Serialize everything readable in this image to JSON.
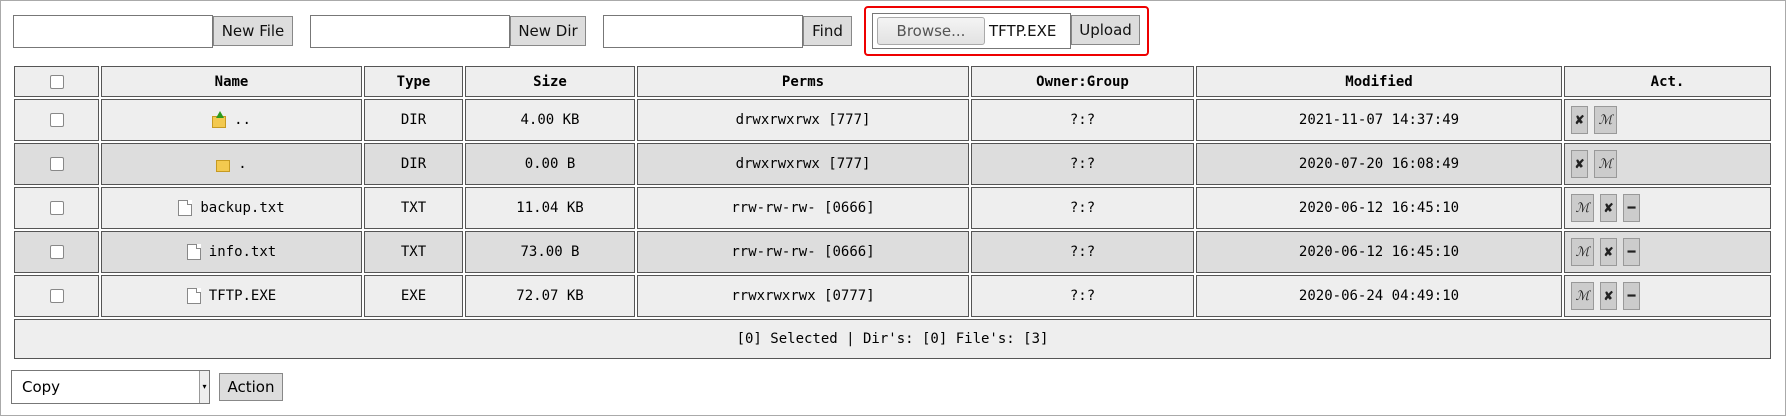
{
  "toolbar": {
    "new_file_label": "New File",
    "new_dir_label": "New Dir",
    "find_label": "Find",
    "browse_label": "Browse...",
    "selected_file": "TFTP.EXE",
    "upload_label": "Upload"
  },
  "table": {
    "headers": [
      "Name",
      "Type",
      "Size",
      "Perms",
      "Owner:Group",
      "Modified",
      "Act."
    ],
    "rows": [
      {
        "icon": "folder-up-icon",
        "name": "..",
        "type": "DIR",
        "size": "4.00 KB",
        "perms": "drwxrwxrwx [777]",
        "owner": "?:?",
        "modified": "2021-11-07 14:37:49",
        "actions": [
          "delete",
          "move"
        ]
      },
      {
        "icon": "folder-icon",
        "name": ".",
        "type": "DIR",
        "size": "0.00 B",
        "perms": "drwxrwxrwx [777]",
        "owner": "?:?",
        "modified": "2020-07-20 16:08:49",
        "actions": [
          "delete",
          "move"
        ]
      },
      {
        "icon": "file-icon",
        "name": "backup.txt",
        "type": "TXT",
        "size": "11.04 KB",
        "perms": "rrw-rw-rw- [0666]",
        "owner": "?:?",
        "modified": "2020-06-12 16:45:10",
        "actions": [
          "move",
          "delete",
          "download"
        ]
      },
      {
        "icon": "file-icon",
        "name": "info.txt",
        "type": "TXT",
        "size": "73.00 B",
        "perms": "rrw-rw-rw- [0666]",
        "owner": "?:?",
        "modified": "2020-06-12 16:45:10",
        "actions": [
          "move",
          "delete",
          "download"
        ]
      },
      {
        "icon": "file-icon",
        "name": "TFTP.EXE",
        "type": "EXE",
        "size": "72.07 KB",
        "perms": "rrwxrwxrwx [0777]",
        "owner": "?:?",
        "modified": "2020-06-24 04:49:10",
        "actions": [
          "move",
          "delete",
          "download"
        ]
      }
    ],
    "footer": "[0] Selected | Dir's: [0] File's: [3]",
    "action_glyphs": {
      "delete": "✘",
      "move": "ℳ",
      "download": "━"
    }
  },
  "bottom": {
    "select_value": "Copy",
    "action_label": "Action"
  }
}
